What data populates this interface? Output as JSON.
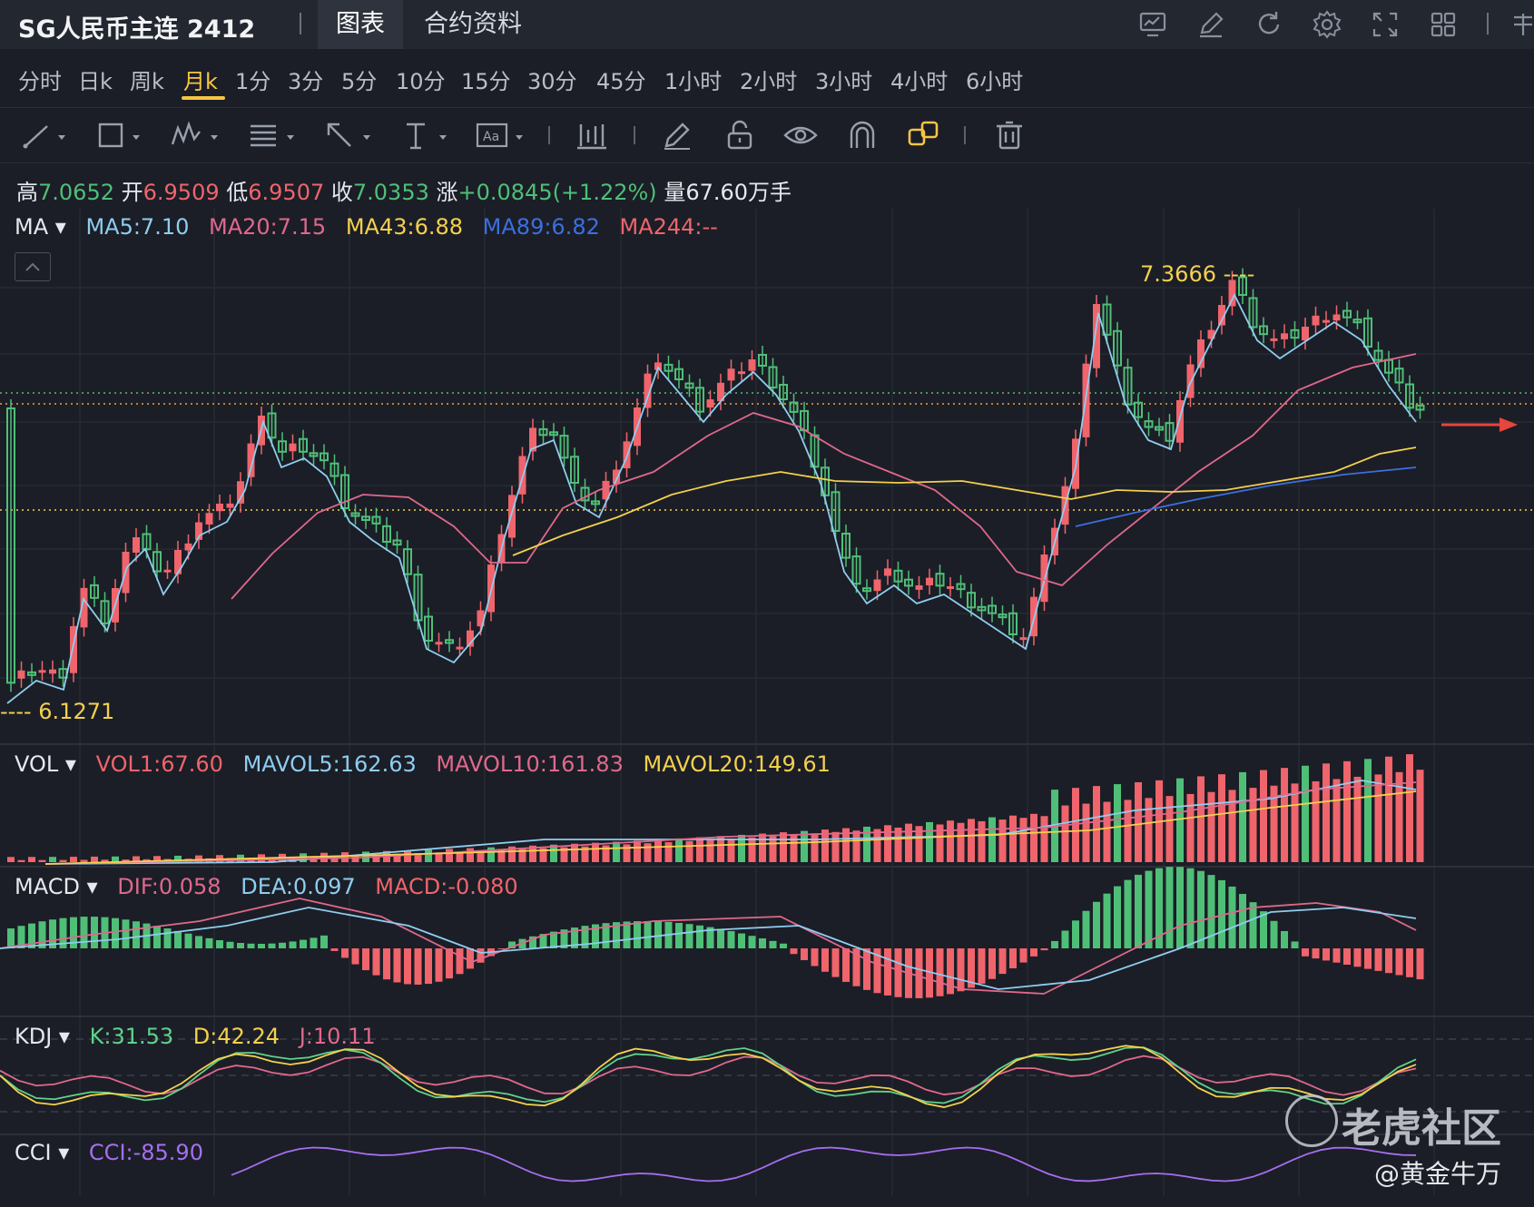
{
  "header": {
    "title": "SG人民币主连 2412",
    "tabs": [
      "图表",
      "合约资料"
    ],
    "active_tab": 0,
    "icons": [
      "chart-indicator-icon",
      "pencil-edit-icon",
      "refresh-icon",
      "settings-gear-icon",
      "fullscreen-icon",
      "layout-grid-icon",
      "more-icon"
    ]
  },
  "periods": {
    "items": [
      "分时",
      "日k",
      "周k",
      "月k",
      "1分",
      "3分",
      "5分",
      "10分",
      "15分",
      "30分",
      "45分",
      "1小时",
      "2小时",
      "3小时",
      "4小时",
      "6小时"
    ],
    "active": 3
  },
  "drawing_tools": [
    "trend-line-icon",
    "rectangle-icon",
    "pattern-icon",
    "fibonacci-icon",
    "arrow-icon",
    "vertical-line-icon",
    "text-tool-icon",
    "bar-measure-icon",
    "pen-icon",
    "lock-icon",
    "eye-icon",
    "magnet-icon",
    "link-icon",
    "trash-icon"
  ],
  "quote": {
    "high_label": "高",
    "high": "7.0652",
    "open_label": "开",
    "open": "6.9509",
    "low_label": "低",
    "low": "6.9507",
    "close_label": "收",
    "close": "7.0353",
    "change_label": "涨",
    "change": "+0.0845(+1.22%)",
    "volume_label": "量",
    "volume": "67.60万手"
  },
  "ma": {
    "label": "MA",
    "items": [
      {
        "text": "MA5:7.10",
        "color": "#8fcdf0"
      },
      {
        "text": "MA20:7.15",
        "color": "#e0688c"
      },
      {
        "text": "MA43:6.88",
        "color": "#f4d04e"
      },
      {
        "text": "MA89:6.82",
        "color": "#3b6fe0"
      },
      {
        "text": "MA244:--",
        "color": "#f0646c"
      }
    ]
  },
  "price_marks": {
    "high": "7.3666 ----",
    "low": "---- 6.1271"
  },
  "vol": {
    "label": "VOL",
    "items": [
      {
        "text": "VOL1:67.60",
        "color": "#f0646c"
      },
      {
        "text": "MAVOL5:162.63",
        "color": "#8fcdf0"
      },
      {
        "text": "MAVOL10:161.83",
        "color": "#e0688c"
      },
      {
        "text": "MAVOL20:149.61",
        "color": "#f4d04e"
      }
    ]
  },
  "macd": {
    "label": "MACD",
    "items": [
      {
        "text": "DIF:0.058",
        "color": "#e0688c"
      },
      {
        "text": "DEA:0.097",
        "color": "#8fcdf0"
      },
      {
        "text": "MACD:-0.080",
        "color": "#f0646c"
      }
    ]
  },
  "kdj": {
    "label": "KDJ",
    "items": [
      {
        "text": "K:31.53",
        "color": "#5fd38b"
      },
      {
        "text": "D:42.24",
        "color": "#f4d04e"
      },
      {
        "text": "J:10.11",
        "color": "#e0688c"
      }
    ]
  },
  "cci": {
    "label": "CCI",
    "items": [
      {
        "text": "CCI:-85.90",
        "color": "#a66ef0"
      }
    ]
  },
  "colors": {
    "up": "#f0646c",
    "down": "#4fbf78",
    "bg": "#1b1e26"
  },
  "watermark": {
    "brand": "老虎社区",
    "author": "@黄金牛万"
  }
}
